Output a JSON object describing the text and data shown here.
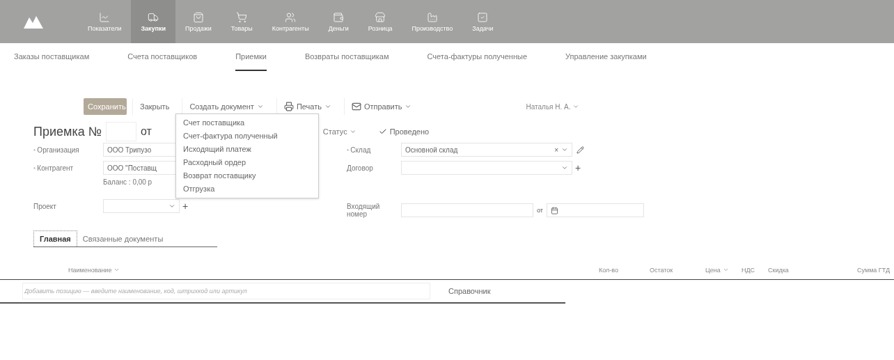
{
  "top_nav": [
    {
      "label": "Показатели",
      "selected": false
    },
    {
      "label": "Закупки",
      "selected": true
    },
    {
      "label": "Продажи",
      "selected": false
    },
    {
      "label": "Товары",
      "selected": false
    },
    {
      "label": "Контрагенты",
      "selected": false
    },
    {
      "label": "Деньги",
      "selected": false
    },
    {
      "label": "Розница",
      "selected": false
    },
    {
      "label": "Производство",
      "selected": false
    },
    {
      "label": "Задачи",
      "selected": false
    }
  ],
  "sub_nav": [
    {
      "label": "Заказы поставщикам",
      "selected": false
    },
    {
      "label": "Счета поставщиков",
      "selected": false
    },
    {
      "label": "Приемки",
      "selected": true
    },
    {
      "label": "Возвраты поставщикам",
      "selected": false
    },
    {
      "label": "Счета-фактуры полученные",
      "selected": false
    },
    {
      "label": "Управление закупками",
      "selected": false
    }
  ],
  "toolbar": {
    "save": "Сохранить",
    "close": "Закрыть",
    "create": "Создать документ",
    "print": "Печать",
    "send": "Отправить",
    "user": "Наталья Н. А."
  },
  "create_menu": [
    "Счет поставщика",
    "Счет-фактура полученный",
    "Исходящий платеж",
    "Расходный ордер",
    "Возврат поставщику",
    "Отгрузка"
  ],
  "document": {
    "title": "Приемка №",
    "from": "от",
    "status": "Статус",
    "posted": {
      "label": "Проведено",
      "checked": true
    }
  },
  "left_fields": [
    {
      "label": "Организация",
      "required": true,
      "value": "ООО Трипузо"
    },
    {
      "label": "Контрагент",
      "required": true,
      "value": "ООО \"Поставщ",
      "note": "Баланс : 0,00 р"
    },
    {
      "label": "Проект",
      "required": false,
      "add": "+"
    }
  ],
  "right_fields": [
    {
      "label": "Склад",
      "required": true,
      "value": "Основной склад",
      "clear": "×"
    },
    {
      "label": "Договор",
      "required": false,
      "add": "+"
    }
  ],
  "required_mark": "*",
  "incoming": {
    "label": "Входящий номер",
    "from": "от"
  },
  "tabs": [
    {
      "label": "Главная",
      "selected": true
    },
    {
      "label": "Связанные документы",
      "selected": false
    }
  ],
  "table": {
    "columns": [
      {
        "label": "Наименование",
        "sortable": true
      },
      {
        "label": "Кол-во",
        "sortable": false
      },
      {
        "label": "Остаток",
        "sortable": false
      },
      {
        "label": "Цена",
        "sortable": true
      },
      {
        "label": "НДС",
        "sortable": false
      },
      {
        "label": "Скидка",
        "sortable": false
      },
      {
        "label": "Сумма ГТД",
        "sortable": false
      }
    ],
    "add_row": {
      "placeholder": "Добавить позицию — введите наименование, код, штрихкод или артикул",
      "catalog": "Справочник"
    }
  }
}
